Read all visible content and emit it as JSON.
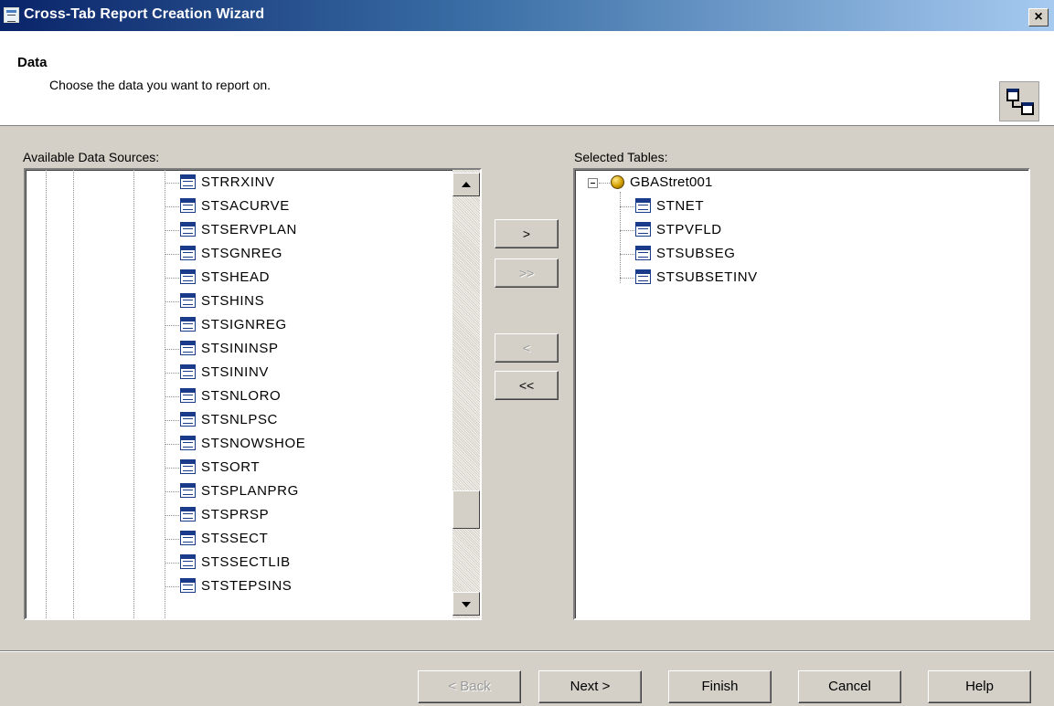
{
  "window": {
    "title": "Cross-Tab Report Creation Wizard",
    "close_label": "×"
  },
  "header": {
    "title": "Data",
    "subtitle": "Choose the data you want to report on."
  },
  "available": {
    "label": "Available Data Sources:",
    "items": [
      "STRRXINV",
      "STSACURVE",
      "STSERVPLAN",
      "STSGNREG",
      "STSHEAD",
      "STSHINS",
      "STSIGNREG",
      "STSININSP",
      "STSININV",
      "STSNLORO",
      "STSNLPSC",
      "STSNOWSHOE",
      "STSORT",
      "STSPLANPRG",
      "STSPRSP",
      "STSSECT",
      "STSSECTLIB",
      "STSTEPSINS"
    ]
  },
  "selected": {
    "label": "Selected Tables:",
    "database": "GBAStret001",
    "items": [
      "STNET",
      "STPVFLD",
      "STSUBSEG",
      "STSUBSETINV"
    ]
  },
  "move_buttons": {
    "add": ">",
    "add_all": ">>",
    "remove": "<",
    "remove_all": "<<"
  },
  "footer": {
    "back": "< Back",
    "next": "Next >",
    "finish": "Finish",
    "cancel": "Cancel",
    "help": "Help"
  }
}
